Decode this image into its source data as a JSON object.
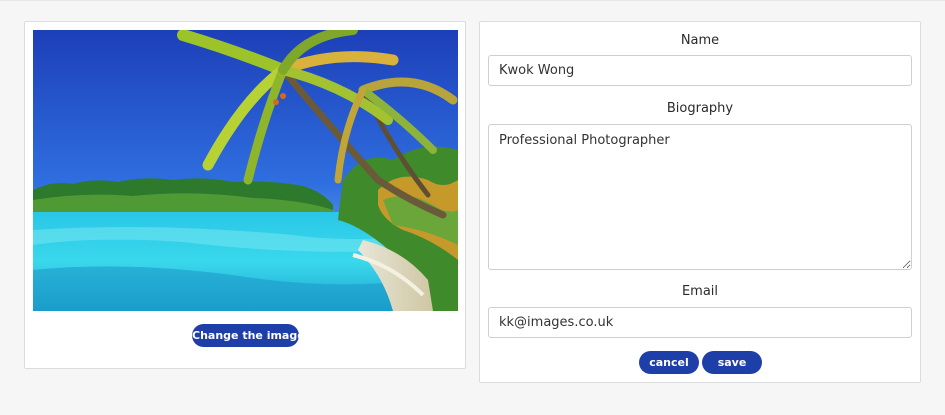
{
  "image_panel": {
    "change_image_label": "Change the image"
  },
  "profile_form": {
    "name_label": "Name",
    "name_value": "Kwok Wong",
    "biography_label": "Biography",
    "biography_value": "Professional Photographer",
    "email_label": "Email",
    "email_value": "kk@images.co.uk",
    "cancel_label": "cancel",
    "save_label": "save"
  },
  "colors": {
    "button": "#1e3fa8",
    "page_background": "#f6f6f6",
    "card_background": "#ffffff"
  }
}
